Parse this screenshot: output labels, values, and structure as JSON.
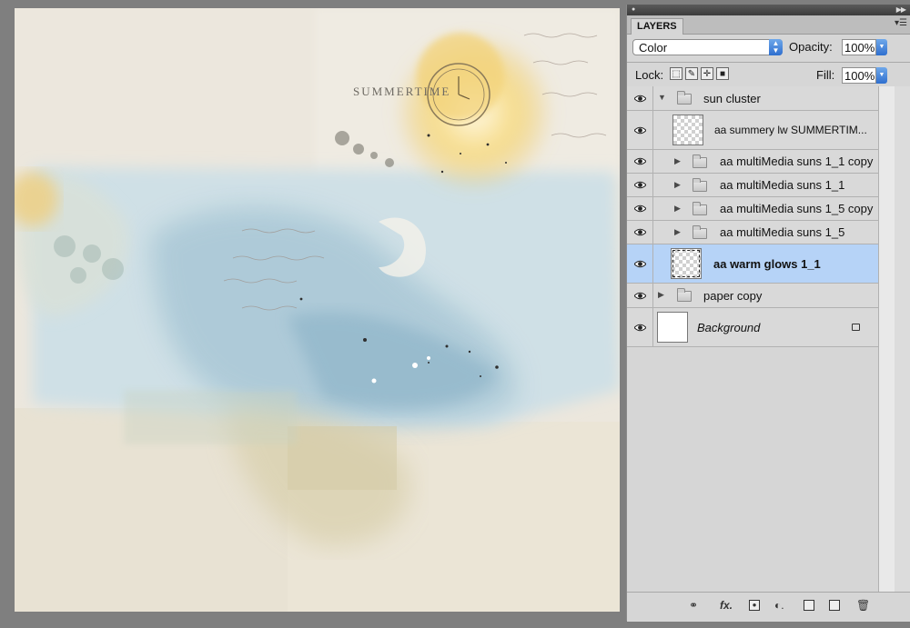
{
  "canvas": {
    "artwork_text": "SUMMERTIME",
    "colors": {
      "paper": "#ebe6dc",
      "blue_wash": "#a9c7d6",
      "yellow_sun": "#f3d37a",
      "sand": "#d8cfaa"
    }
  },
  "layers_panel": {
    "tab_label": "LAYERS",
    "blend_mode": "Color",
    "opacity_label": "Opacity:",
    "opacity_value": "100%",
    "lock_label": "Lock:",
    "fill_label": "Fill:",
    "fill_value": "100%",
    "layers": [
      {
        "name": "sun cluster",
        "type": "group",
        "expanded": true
      },
      {
        "name": "aa summery lw SUMMERTIM...",
        "type": "layer"
      },
      {
        "name": "aa multiMedia suns 1_1 copy",
        "type": "group"
      },
      {
        "name": "aa multiMedia suns 1_1",
        "type": "group"
      },
      {
        "name": "aa multiMedia suns 1_5 copy",
        "type": "group"
      },
      {
        "name": "aa multiMedia suns 1_5",
        "type": "group"
      },
      {
        "name": "aa warm glows 1_1",
        "type": "layer",
        "selected": true
      },
      {
        "name": "paper copy",
        "type": "group"
      },
      {
        "name": "Background",
        "type": "layer",
        "locked": true
      }
    ],
    "selection_color": "#b6d3f7",
    "bottom_icons": [
      "link-icon",
      "fx-icon",
      "mask-icon",
      "adjustment-icon",
      "new-group-icon",
      "new-layer-icon",
      "trash-icon"
    ],
    "fx_label": "fx."
  }
}
